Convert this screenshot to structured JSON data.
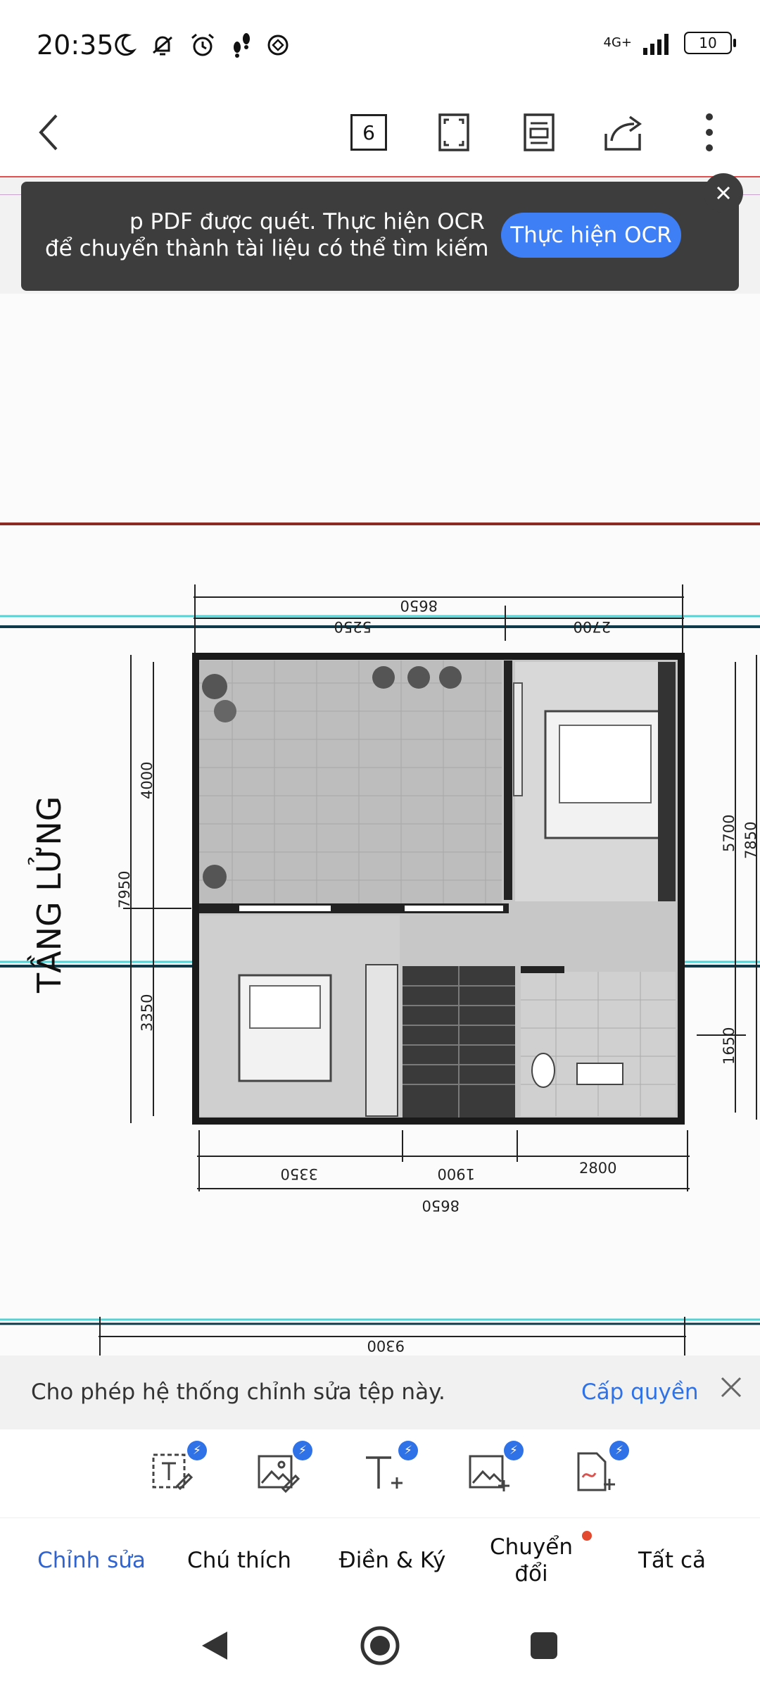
{
  "status_bar": {
    "time": "20:35",
    "network": "4G+",
    "battery": "10",
    "icons": [
      "moon-icon",
      "bell-off-icon",
      "alarm-icon",
      "footsteps-icon",
      "app-icon"
    ]
  },
  "toolbar": {
    "page_count": "6",
    "icons": [
      "back-arrow-icon",
      "fullscreen-icon",
      "reading-mode-icon",
      "share-icon",
      "more-vertical-icon"
    ]
  },
  "ocr_banner": {
    "line1": "p PDF được quét. Thực hiện OCR",
    "line2": "để chuyển thành tài liệu có thể tìm kiếm",
    "button": "Thực hiện OCR"
  },
  "blueprint": {
    "title": "TẦNG LỬNG",
    "dims_top": [
      "8650",
      "5250",
      "2700"
    ],
    "dims_bottom": [
      "3350",
      "1900",
      "2800",
      "8650"
    ],
    "dims_left": [
      "4000",
      "7950",
      "3350"
    ],
    "dims_right": [
      "5700",
      "7850",
      "1650"
    ],
    "dim_lower": "9300"
  },
  "permission": {
    "text": "Cho phép hệ thống chỉnh sửa tệp này.",
    "link": "Cấp quyền"
  },
  "tools": [
    "edit-text-icon",
    "edit-image-icon",
    "add-text-icon",
    "add-image-icon",
    "signature-file-icon"
  ],
  "tabs": {
    "edit": "Chỉnh sửa",
    "annotate": "Chú thích",
    "fill_sign": "Điền & Ký",
    "convert_line1": "Chuyển",
    "convert_line2": "đổi",
    "all": "Tất cả"
  },
  "colors": {
    "accent": "#3f7ff5",
    "link": "#2f72e8",
    "banner_bg": "#3d3d3d",
    "notify_dot": "#e3492f"
  }
}
